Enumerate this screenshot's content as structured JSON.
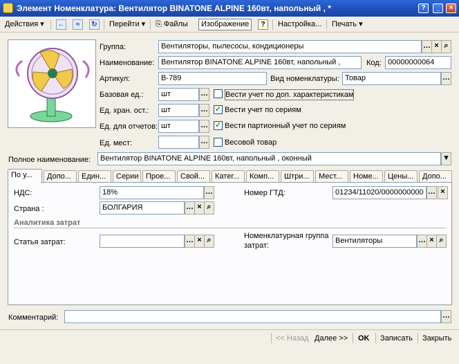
{
  "window": {
    "title": "Элемент Номенклатура: Вентилятор BINATONE ALPINE 160вт, напольный , *"
  },
  "toolbar": {
    "actions": "Действия",
    "goto": "Перейти",
    "files": "Файлы",
    "image": "Изображение",
    "help": "?",
    "settings": "Настройка...",
    "print": "Печать"
  },
  "form": {
    "group_label": "Группа:",
    "group_value": "Вентиляторы, пылесосы, кондиционеры",
    "name_label": "Наименование:",
    "name_value": "Вентилятор BINATONE ALPINE 160вт, напольный ,",
    "code_label": "Код:",
    "code_value": "00000000064",
    "article_label": "Артикул:",
    "article_value": "B-789",
    "kind_label": "Вид номенклатуры:",
    "kind_value": "Товар",
    "base_unit_label": "Базовая ед.:",
    "base_unit_value": "шт",
    "storage_unit_label": "Ед. хран. ост.:",
    "storage_unit_value": "шт",
    "report_unit_label": "Ед. для отчетов:",
    "report_unit_value": "шт",
    "places_label": "Ед. мест:",
    "places_value": "",
    "chk_char_label": "Вести учет по доп. характеристикам",
    "chk_char": false,
    "chk_series_label": "Вести учет по сериям",
    "chk_series": true,
    "chk_batch_label": "Вести партионный учет по сериям",
    "chk_batch": true,
    "chk_weight_label": "Весовой товар",
    "chk_weight": false,
    "fullname_label": "Полное наименование:",
    "fullname_value": "Вентилятор BINATONE ALPINE 160вт, напольный , оконный"
  },
  "tabs": [
    "По у...",
    "Допо...",
    "Един...",
    "Серии",
    "Прое...",
    "Свой...",
    "Катег...",
    "Комп...",
    "Штри...",
    "Мест...",
    "Номе...",
    "Цены...",
    "Допо..."
  ],
  "tab_panel": {
    "vat_label": "НДС:",
    "vat_value": "18%",
    "gtd_label": "Номер ГТД:",
    "gtd_value": "01234/11020/0000000000",
    "country_label": "Страна :",
    "country_value": "БОЛГАРИЯ",
    "section_title": "Аналитика затрат",
    "cost_item_label": "Статья затрат:",
    "cost_item_value": "",
    "nom_group_label_1": "Номенклатурная группа",
    "nom_group_label_2": "затрат:",
    "nom_group_value": "Вентиляторы"
  },
  "comment": {
    "label": "Комментарий:",
    "value": ""
  },
  "bottom": {
    "back": "<< Назад",
    "next": "Далее >>",
    "ok": "OK",
    "save": "Записать",
    "close": "Закрыть"
  },
  "colors": {
    "titlebar": "#2157c8",
    "window_bg": "#f2efe7",
    "field_border": "#7f9db9",
    "section_title": "#6d6d6d"
  }
}
